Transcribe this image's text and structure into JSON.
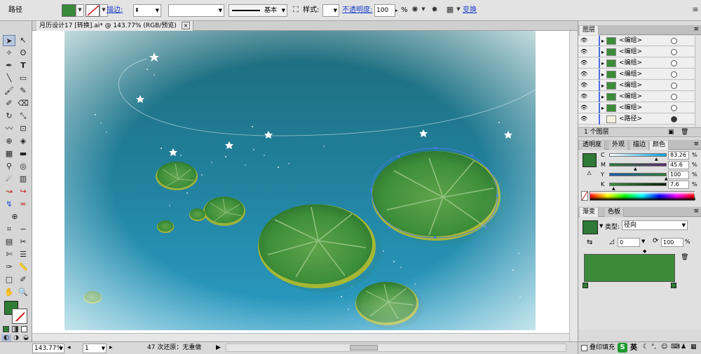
{
  "control_bar": {
    "selection_label": "路径",
    "fill_color": "#3a8a3c",
    "stroke_label": "描边:",
    "brush_label": "基本",
    "style_label": "样式:",
    "opacity_label": "不透明度:",
    "opacity_value": "100",
    "opacity_unit": "%",
    "transform_label": "变换"
  },
  "document": {
    "tab_title": "月历设计17 [转换].ai* @ 143.77% (RGB/预览)",
    "close_glyph": "×"
  },
  "status_bar": {
    "zoom": "143.77%",
    "artboard": "1",
    "undo_text": "47 次还原：无重做"
  },
  "layers_panel": {
    "title": "图层",
    "rows": [
      {
        "name": "<编组>"
      },
      {
        "name": "<编组>"
      },
      {
        "name": "<编组>"
      },
      {
        "name": "<编组>"
      },
      {
        "name": "<编组>"
      },
      {
        "name": "<编组>"
      },
      {
        "name": "<编组>"
      },
      {
        "name": "<路径>"
      }
    ],
    "footer": "1 个图层"
  },
  "color_panel": {
    "tabs": [
      "透明度",
      "外观",
      "描边",
      "颜色"
    ],
    "active_tab": "颜色",
    "swatch_color": "#2e7a36",
    "sliders": [
      {
        "label": "C",
        "value": "83.26",
        "fraction": 0.83
      },
      {
        "label": "M",
        "value": "45.6",
        "fraction": 0.46
      },
      {
        "label": "Y",
        "value": "100",
        "fraction": 1.0
      },
      {
        "label": "K",
        "value": "7.6",
        "fraction": 0.08
      }
    ],
    "unit": "%"
  },
  "gradient_panel": {
    "tabs": [
      "渐变",
      "色板"
    ],
    "type_label": "类型:",
    "type_value": "径向",
    "angle_value": "0",
    "aspect_value": "100",
    "unit": "%"
  },
  "bottom_panel": {
    "checkbox_label": "叠印填充",
    "ime_label": "英"
  },
  "canvas_colors": {
    "water_top": "#1e6b7a",
    "water_bottom": "#2a9cc4",
    "pad_green": "#3e8f3a",
    "pad_edge": "#a6b734"
  }
}
